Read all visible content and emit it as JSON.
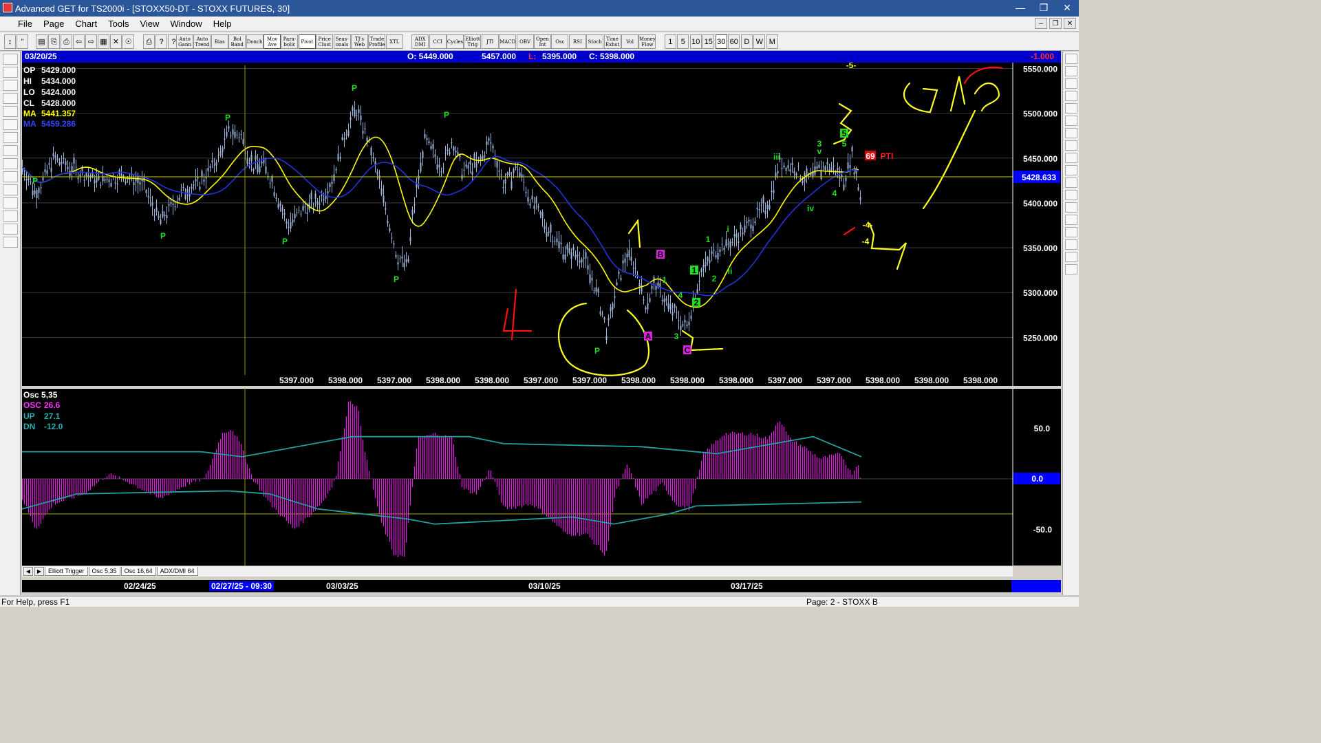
{
  "window": {
    "title": "Advanced GET for TS2000i - [STOXX50-DT - STOXX FUTURES, 30]",
    "controls": [
      "minimize-icon",
      "restore-icon",
      "close-icon"
    ]
  },
  "menu": {
    "items": [
      "File",
      "Page",
      "Chart",
      "Tools",
      "View",
      "Window",
      "Help"
    ]
  },
  "toolbar": {
    "studies": [
      {
        "label": "Auto Gann",
        "name": "auto-gann"
      },
      {
        "label": "Auto Trend",
        "name": "auto-trend"
      },
      {
        "label": "Bias",
        "name": "bias"
      },
      {
        "label": "Bol Band",
        "name": "bol-band"
      },
      {
        "label": "Donch",
        "name": "donch"
      },
      {
        "label": "Mov Ave",
        "name": "mov-ave"
      },
      {
        "label": "Para- bolic",
        "name": "parabolic"
      },
      {
        "label": "Pivot",
        "name": "pivot"
      },
      {
        "label": "Price Clust",
        "name": "price-clust"
      },
      {
        "label": "Seas- onals",
        "name": "seasonals"
      },
      {
        "label": "TJ's Web",
        "name": "tjs-web"
      },
      {
        "label": "Trade Profile",
        "name": "trade-profile"
      },
      {
        "label": "XTL",
        "name": "xtl"
      },
      {
        "label": "ADX DMI",
        "name": "adx-dmi"
      },
      {
        "label": "CCI",
        "name": "cci"
      },
      {
        "label": "Cycles",
        "name": "cycles"
      },
      {
        "label": "Elliott Trig",
        "name": "elliott-trig"
      },
      {
        "label": "JTI",
        "name": "jti"
      },
      {
        "label": "MACD",
        "name": "macd"
      },
      {
        "label": "OBV",
        "name": "obv"
      },
      {
        "label": "Open Int",
        "name": "open-int"
      },
      {
        "label": "Osc",
        "name": "osc"
      },
      {
        "label": "RSI",
        "name": "rsi"
      },
      {
        "label": "Stoch",
        "name": "stoch"
      },
      {
        "label": "Time Exhst",
        "name": "time-exhst"
      },
      {
        "label": "Vol",
        "name": "vol"
      },
      {
        "label": "Money Flow",
        "name": "money-flow"
      }
    ],
    "intervals": [
      "1",
      "5",
      "10",
      "15",
      "30",
      "60",
      "D",
      "W",
      "M"
    ],
    "active_interval": "30"
  },
  "infobar": {
    "date": "03/20/25",
    "open": "O: 5449.000",
    "high": "5457.000",
    "low_prefix": "L:",
    "low": "5395.000",
    "close": "C: 5398.000",
    "change": "-1.000"
  },
  "legend": {
    "op": {
      "label": "OP",
      "value": "5429.000"
    },
    "hi": {
      "label": "HI",
      "value": "5434.000"
    },
    "lo": {
      "label": "LO",
      "value": "5424.000"
    },
    "cl": {
      "label": "CL",
      "value": "5428.000"
    },
    "ma1": {
      "label": "MA",
      "value": "5441.357",
      "color": "#ffff00"
    },
    "ma2": {
      "label": "MA",
      "value": "5459.286",
      "color": "#2222ff"
    }
  },
  "price_axis": {
    "ticks": [
      "5550.000",
      "5500.000",
      "5450.000",
      "5400.000",
      "5350.000",
      "5300.000",
      "5250.000"
    ],
    "current": "5428.633"
  },
  "bottom_values": [
    "5397.000",
    "5398.000",
    "5397.000",
    "5398.000",
    "5398.000",
    "5397.000",
    "5397.000",
    "5398.000",
    "5398.000",
    "5398.000",
    "5397.000",
    "5397.000",
    "5398.000",
    "5398.000",
    "5398.000"
  ],
  "markers": {
    "pivot": "P",
    "wave_a": "A",
    "wave_b": "B",
    "wave_c": "C",
    "waves": [
      "1",
      "2",
      "3",
      "4",
      "5",
      "i",
      "ii",
      "iii",
      "iv",
      "v"
    ],
    "pti_value": "69",
    "pti_label": "PTI",
    "target_4": "-4-",
    "target_4b": "-4",
    "top_mark": "-5-"
  },
  "osc": {
    "title": "Osc 5,35",
    "osc_label": "OSC",
    "osc_value": "26.6",
    "up_label": "UP",
    "up_value": "27.1",
    "dn_label": "DN",
    "dn_value": "-12.0",
    "ticks": [
      "50.0",
      "0.0",
      "-50.0"
    ]
  },
  "tabs": [
    "Elliott Trigger",
    "Osc 5,35",
    "Osc 16,64",
    "ADX/DMI 64"
  ],
  "dates": [
    "02/24/25",
    "02/27/25 - 09:30",
    "03/03/25",
    "03/10/25",
    "03/17/25"
  ],
  "status": {
    "help": "For Help, press F1",
    "page": "Page: 2 - STOXX B"
  },
  "colors": {
    "chart_bg": "#000000",
    "bars": "#9ab4dc",
    "pivot": "#22dd22",
    "ma_yellow": "#ffff00",
    "ma_blue": "#2233dd",
    "osc": "#dd22dd",
    "bands": "#22a0a0",
    "annotation_red": "#ff1111",
    "annotation_yellow": "#ffff22"
  }
}
